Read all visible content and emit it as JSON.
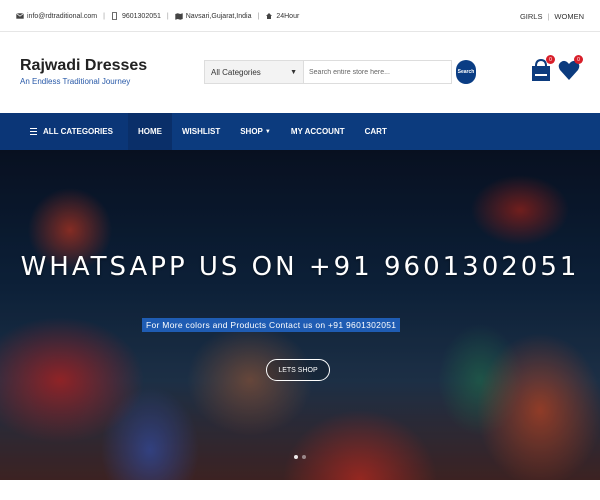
{
  "topbar": {
    "email": "info@rdtraditional.com",
    "phone": "9601302051",
    "location": "Navsari,Gujarat,India",
    "hours": "24Hour",
    "links": [
      "GIRLS",
      "WOMEN"
    ]
  },
  "header": {
    "brand_name": "Rajwadi Dresses",
    "tagline": "An Endless Traditional Journey",
    "category_select": "All Categories",
    "search_placeholder": "Search entire store here...",
    "search_button": "Search",
    "cart_count": "0",
    "wishlist_count": "0"
  },
  "nav": {
    "all_categories": "ALL CATEGORIES",
    "items": [
      "HOME",
      "WISHLIST",
      "SHOP",
      "MY ACCOUNT",
      "CART"
    ]
  },
  "hero": {
    "title": "WHATSAPP US ON +91 9601302051",
    "subtitle": "For More colors and Products Contact us on +91 9601302051",
    "button": "LETS SHOP"
  },
  "colors": {
    "brand_blue": "#0c3b7e",
    "accent_blue": "#2859a8",
    "badge_red": "#d81f2a"
  },
  "icons": [
    "envelope-icon",
    "phone-icon",
    "map-icon",
    "clock-icon",
    "bag-icon",
    "heart-icon",
    "menu-icon",
    "caret-down-icon"
  ]
}
